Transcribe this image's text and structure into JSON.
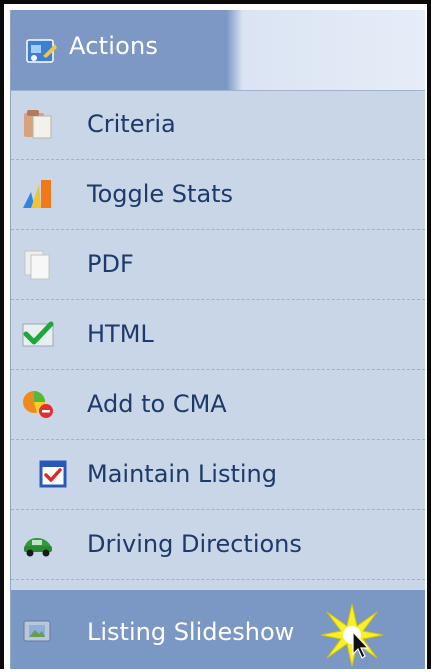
{
  "menu": {
    "header_label": "Actions",
    "items": [
      {
        "label": "Criteria",
        "icon": "clipboard-icon"
      },
      {
        "label": "Toggle Stats",
        "icon": "bar-chart-icon"
      },
      {
        "label": "PDF",
        "icon": "document-icon"
      },
      {
        "label": "HTML",
        "icon": "checkmark-icon"
      },
      {
        "label": "Add to CMA",
        "icon": "add-to-cma-icon"
      },
      {
        "label": "Maintain Listing",
        "icon": "checkbox-icon"
      },
      {
        "label": "Driving Directions",
        "icon": "car-icon"
      },
      {
        "label": "Listing Slideshow",
        "icon": "slideshow-icon",
        "selected": true
      }
    ]
  },
  "colors": {
    "header_bg": "#7d98c4",
    "menu_bg": "#c9d6e8",
    "item_text": "#1d3a6a",
    "selected_bg": "#7b97c3"
  }
}
